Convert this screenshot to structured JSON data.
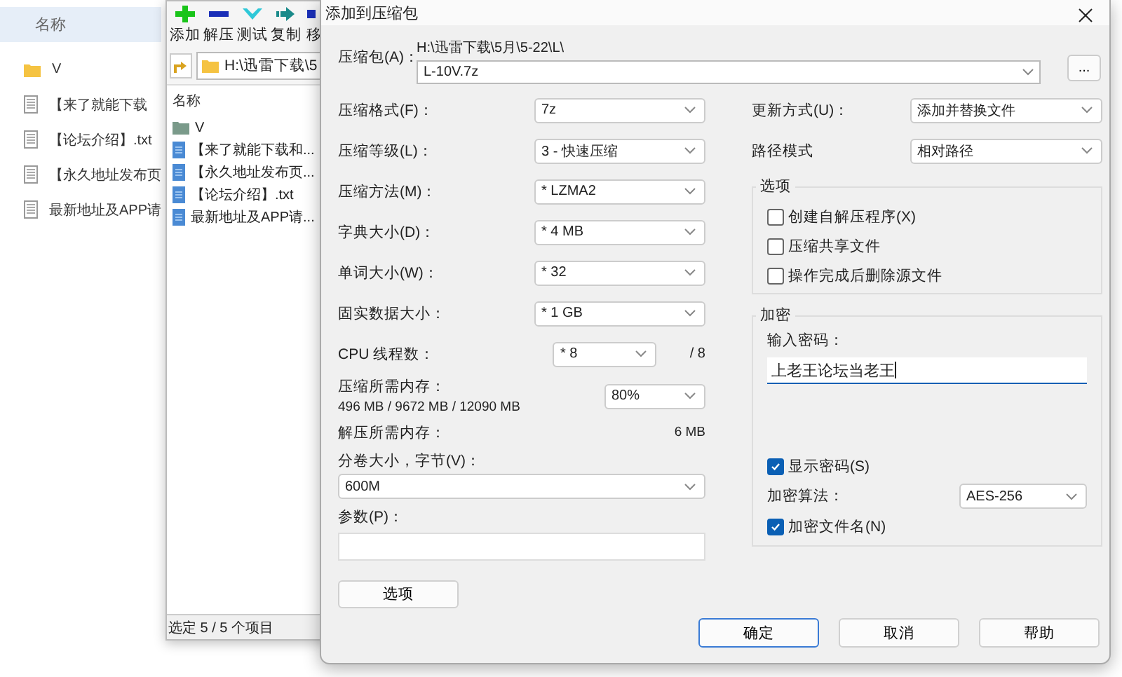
{
  "explorer": {
    "column_header": "名称",
    "items": [
      {
        "name": "V",
        "kind": "folder"
      },
      {
        "name": "【来了就能下载",
        "kind": "file"
      },
      {
        "name": "【论坛介绍】.txt",
        "kind": "file"
      },
      {
        "name": "【永久地址发布页",
        "kind": "file"
      },
      {
        "name": "最新地址及APP请",
        "kind": "file"
      }
    ]
  },
  "file_manager": {
    "toolbar": [
      {
        "label": "添加",
        "kind": "add"
      },
      {
        "label": "解压",
        "kind": "extract"
      },
      {
        "label": "测试",
        "kind": "test"
      },
      {
        "label": "复制",
        "kind": "copy"
      },
      {
        "label": "移",
        "kind": "move"
      }
    ],
    "path": "H:\\迅雷下载\\5",
    "column_header": "名称",
    "items": [
      {
        "name": "V",
        "kind": "folder"
      },
      {
        "name": "【来了就能下载和...",
        "kind": "file"
      },
      {
        "name": "【永久地址发布页...",
        "kind": "file"
      },
      {
        "name": "【论坛介绍】.txt",
        "kind": "file"
      },
      {
        "name": "最新地址及APP请...",
        "kind": "file"
      }
    ],
    "status": "选定 5 / 5 个项目"
  },
  "dialog": {
    "title": "添加到压缩包",
    "archive": {
      "label": "压缩包(A)：",
      "folder": "H:\\迅雷下载\\5月\\5-22\\L\\",
      "name": "L-10V.7z",
      "browse": "..."
    },
    "settings": [
      {
        "label": "压缩格式(F)：",
        "value": "7z"
      },
      {
        "label": "压缩等级(L)：",
        "value": "3 - 快速压缩"
      },
      {
        "label": "压缩方法(M)：",
        "value": "* LZMA2"
      },
      {
        "label": "字典大小(D)：",
        "value": "* 4 MB"
      },
      {
        "label": "单词大小(W)：",
        "value": "* 32"
      },
      {
        "label": "固实数据大小：",
        "value": "* 1 GB"
      }
    ],
    "cpu": {
      "label": "CPU 线程数：",
      "value": "* 8",
      "total": "/ 8"
    },
    "memory": {
      "label": "压缩所需内存：",
      "detail": "496 MB / 9672 MB / 12090 MB",
      "value": "80%"
    },
    "decompress_memory": {
      "label": "解压所需内存：",
      "value": "6 MB"
    },
    "volume": {
      "label": "分卷大小，字节(V)：",
      "value": "600M"
    },
    "parameters": {
      "label": "参数(P)："
    },
    "options_button": "选项",
    "update_mode": {
      "label": "更新方式(U)：",
      "value": "添加并替换文件"
    },
    "path_mode": {
      "label": "路径模式",
      "value": "相对路径"
    },
    "options_group": {
      "title": "选项",
      "checkboxes": [
        {
          "label": "创建自解压程序(X)",
          "checked": false
        },
        {
          "label": "压缩共享文件",
          "checked": false
        },
        {
          "label": "操作完成后删除源文件",
          "checked": false
        }
      ]
    },
    "encryption": {
      "title": "加密",
      "password_label": "输入密码：",
      "password": "上老王论坛当老王",
      "show_password": {
        "label": "显示密码(S)",
        "checked": true
      },
      "method_label": "加密算法：",
      "method": "AES-256",
      "encrypt_names": {
        "label": "加密文件名(N)",
        "checked": true
      }
    },
    "buttons": [
      {
        "label": "确定",
        "default": true
      },
      {
        "label": "取消",
        "default": false
      },
      {
        "label": "帮助",
        "default": false
      }
    ]
  }
}
